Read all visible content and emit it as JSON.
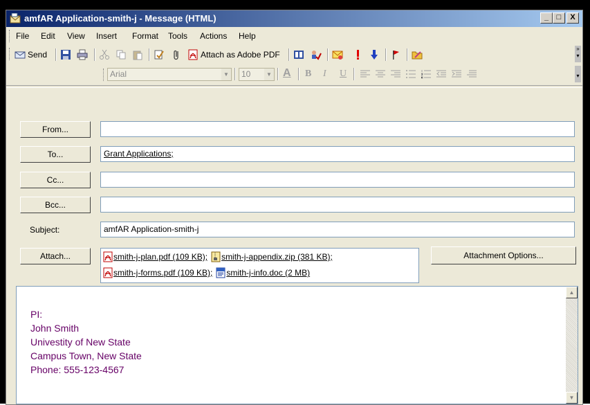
{
  "window": {
    "title": "amfAR Application-smith-j - Message (HTML)",
    "controls": [
      "_",
      "□",
      "X"
    ]
  },
  "menu": [
    "File",
    "Edit",
    "View",
    "Insert",
    "Format",
    "Tools",
    "Actions",
    "Help"
  ],
  "toolbar": {
    "send_label": "Send",
    "attach_pdf_label": "Attach as Adobe PDF"
  },
  "format_bar": {
    "font": "Arial",
    "size": "10",
    "bold": "B",
    "italic": "I",
    "underline": "U"
  },
  "header": {
    "from_button": "From...",
    "to_button": "To...",
    "cc_button": "Cc...",
    "bcc_button": "Bcc...",
    "subject_label": "Subject:",
    "attach_button": "Attach...",
    "attachment_options_button": "Attachment Options...",
    "from_value": "",
    "to_value": "Grant Applications;",
    "cc_value": "",
    "bcc_value": "",
    "subject_value": "amfAR Application-smith-j"
  },
  "attachments": [
    {
      "name": "smith-j-plan.pdf (109 KB);",
      "icon": "pdf-icon"
    },
    {
      "name": "smith-j-appendix.zip (381 KB);",
      "icon": "zip-icon"
    },
    {
      "name": "smith-j-forms.pdf (109 KB);",
      "icon": "pdf-icon"
    },
    {
      "name": "smith-j-info.doc (2 MB)",
      "icon": "word-doc-icon"
    }
  ],
  "body": {
    "lines": [
      "PI:",
      "John Smith",
      "Univestity of New State",
      "Campus Town, New State",
      "Phone: 555-123-4567"
    ]
  },
  "colors": {
    "title_gradient_start": "#0a246a",
    "title_gradient_end": "#a6caf0",
    "body_text_purple": "#660066"
  }
}
